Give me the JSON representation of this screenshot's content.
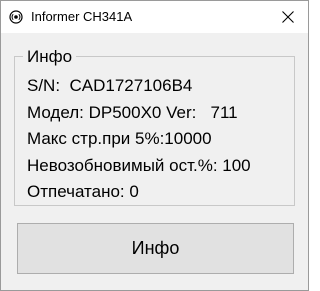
{
  "window": {
    "title": "Informer CH341A",
    "title_icon": "radio-icon",
    "close_icon": "close-icon"
  },
  "group": {
    "legend": "Инфо",
    "lines": [
      "S/N:  CAD1727106B4",
      "Модел: DP500X0 Ver:   711",
      "Макс стр.при 5%:10000",
      "Невозобновимый ост.%: 100",
      "Отпечатано: 0"
    ]
  },
  "button": {
    "label": "Инфо"
  }
}
